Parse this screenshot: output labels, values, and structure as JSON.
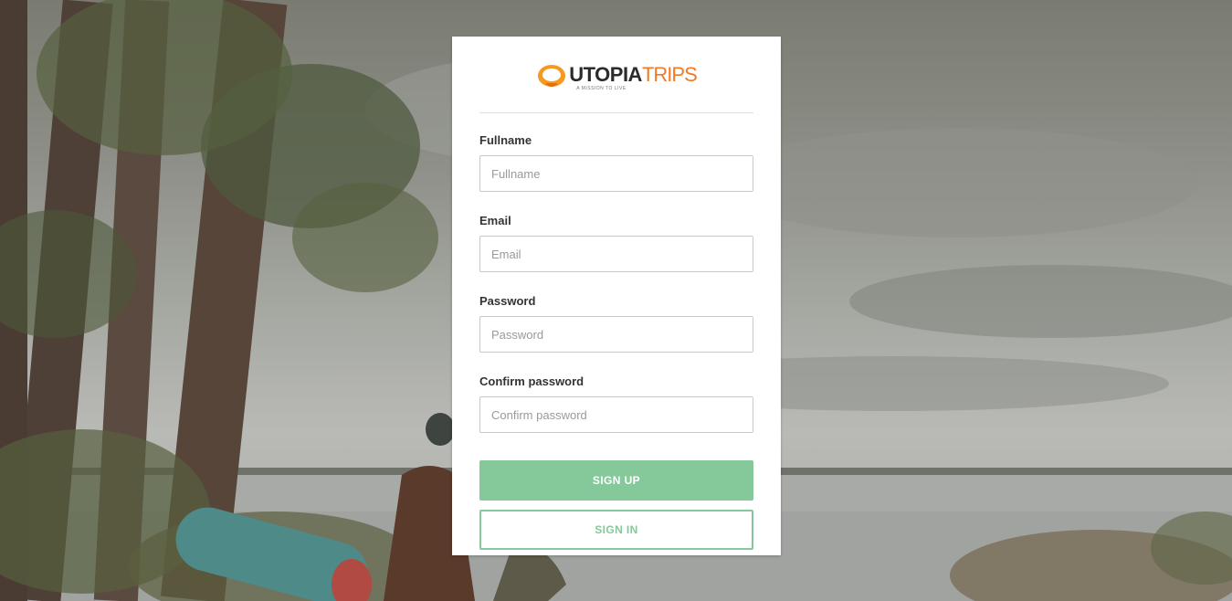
{
  "brand": {
    "word1": "UTOPIA",
    "word2": "TRIPS",
    "tagline": "A MISSION TO LIVE",
    "accent_color": "#f07b26"
  },
  "form": {
    "fields": [
      {
        "id": "fullname",
        "label": "Fullname",
        "placeholder": "Fullname",
        "type": "text"
      },
      {
        "id": "email",
        "label": "Email",
        "placeholder": "Email",
        "type": "email"
      },
      {
        "id": "password",
        "label": "Password",
        "placeholder": "Password",
        "type": "password"
      },
      {
        "id": "confirm",
        "label": "Confirm password",
        "placeholder": "Confirm password",
        "type": "password"
      }
    ],
    "signup_label": "SIGN UP",
    "signin_label": "SIGN IN",
    "button_color": "#85c99a"
  },
  "background": {
    "description_icon": "lakeside-forest-photo"
  }
}
